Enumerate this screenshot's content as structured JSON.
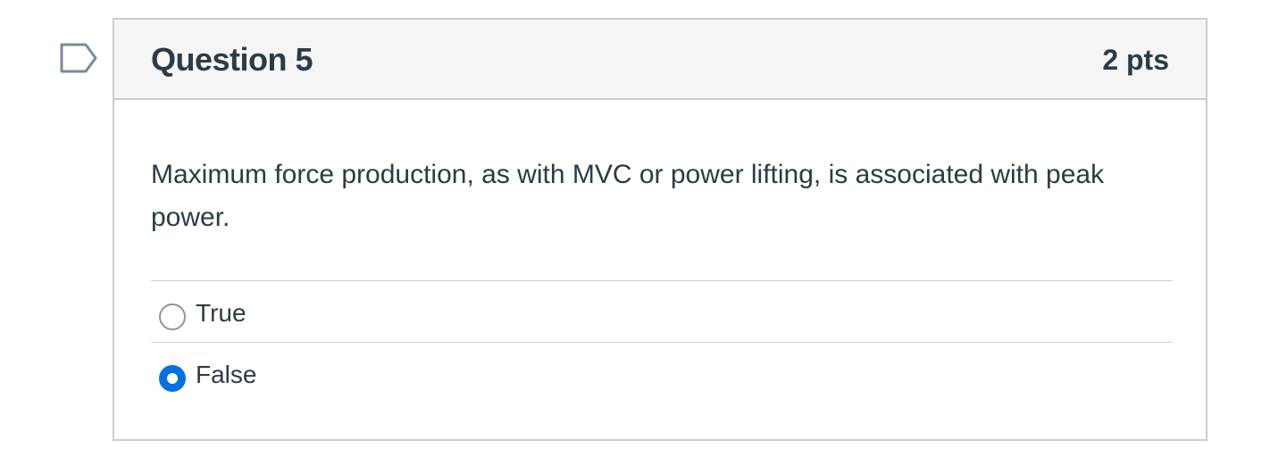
{
  "question": {
    "title": "Question 5",
    "points": "2 pts",
    "text": "Maximum force production, as with MVC or power lifting, is associated with peak power.",
    "flag_icon": "flag-outline-icon"
  },
  "answers": [
    {
      "label": "True",
      "selected": false
    },
    {
      "label": "False",
      "selected": true
    }
  ],
  "colors": {
    "accent": "#0770e0",
    "text": "#2d3b45",
    "border": "#c7cdd1",
    "header_bg": "#f5f5f5"
  }
}
